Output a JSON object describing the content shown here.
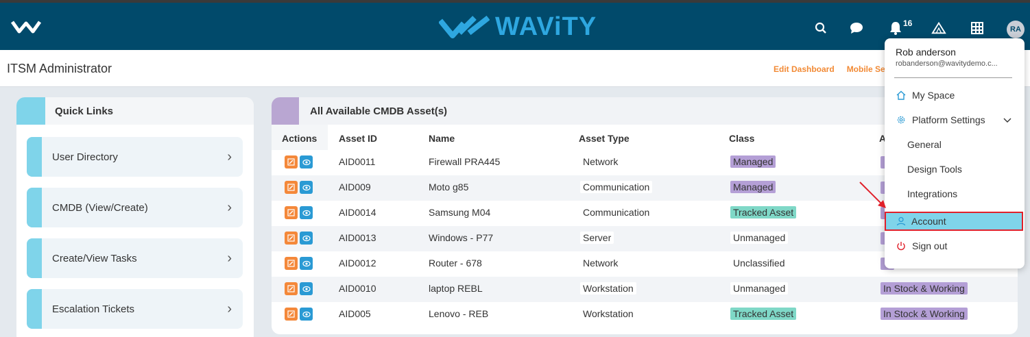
{
  "topbar": {
    "brand": "WAViTY",
    "notification_count": "16",
    "avatar_initials": "RA"
  },
  "subheader": {
    "page_title": "ITSM Administrator",
    "edit_dashboard": "Edit Dashboard",
    "mobile_settings": "Mobile Se"
  },
  "quick_links": {
    "title": "Quick Links",
    "items": [
      {
        "label": "User Directory"
      },
      {
        "label": "CMDB (View/Create)"
      },
      {
        "label": "Create/View Tasks"
      },
      {
        "label": "Escalation Tickets"
      }
    ]
  },
  "assets": {
    "title": "All Available CMDB Asset(s)",
    "columns": [
      "Actions",
      "Asset ID",
      "Name",
      "Asset Type",
      "Class",
      "A"
    ],
    "rows": [
      {
        "id": "AID0011",
        "name": "Firewall PRA445",
        "type": "Network",
        "class": "Managed",
        "class_style": "managed",
        "avail": ""
      },
      {
        "id": "AID009",
        "name": "Moto g85",
        "type": "Communication",
        "class": "Managed",
        "class_style": "managed",
        "avail": ""
      },
      {
        "id": "AID0014",
        "name": "Samsung M04",
        "type": "Communication",
        "class": "Tracked Asset",
        "class_style": "tracked",
        "avail": ""
      },
      {
        "id": "AID0013",
        "name": "Windows - P77",
        "type": "Server",
        "class": "Unmanaged",
        "class_style": "plain",
        "avail": ""
      },
      {
        "id": "AID0012",
        "name": "Router - 678",
        "type": "Network",
        "class": "Unclassified",
        "class_style": "plain",
        "avail": ""
      },
      {
        "id": "AID0010",
        "name": "laptop REBL",
        "type": "Workstation",
        "class": "Unmanaged",
        "class_style": "plain",
        "avail": "In Stock & Working"
      },
      {
        "id": "AID005",
        "name": "Lenovo - REB",
        "type": "Workstation",
        "class": "Tracked Asset",
        "class_style": "tracked",
        "avail": "In Stock & Working"
      }
    ]
  },
  "user_menu": {
    "name": "Rob anderson",
    "email": "robanderson@wavitydemo.c...",
    "my_space": "My Space",
    "platform_settings": "Platform Settings",
    "sub_items": [
      "General",
      "Design Tools",
      "Integrations"
    ],
    "account": "Account",
    "sign_out": "Sign out"
  },
  "colors": {
    "topbar": "#014a6b",
    "brand": "#2ea7e0",
    "accent_orange": "#f28a35",
    "highlight_border": "#e0202a"
  }
}
